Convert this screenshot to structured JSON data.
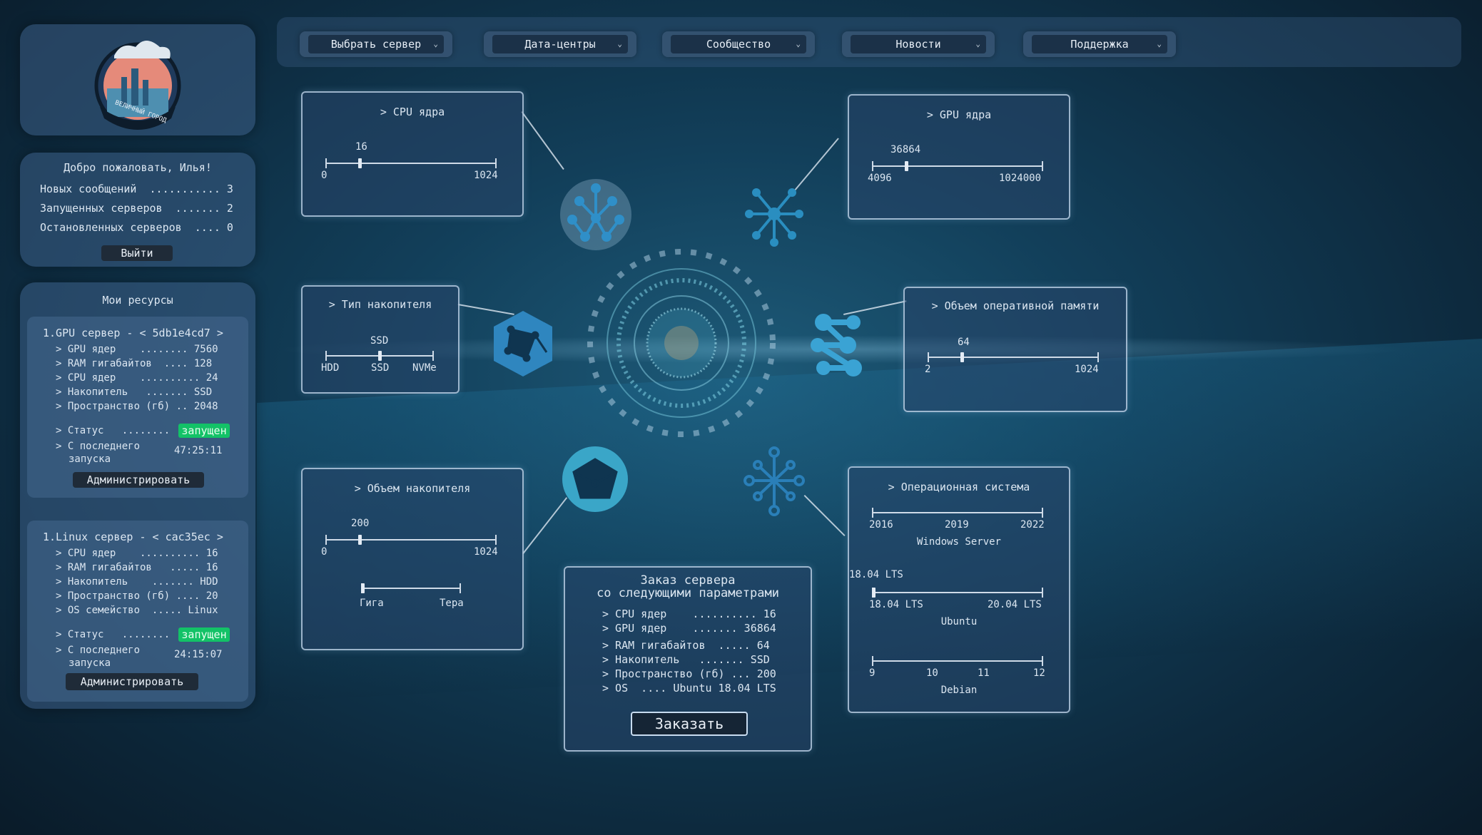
{
  "nav": {
    "items": [
      "Выбрать сервер",
      "Дата-центры",
      "Сообщество",
      "Новости",
      "Поддержка"
    ]
  },
  "logo": {
    "text": "ВЕЛИЧНЫЙ ГОРОД"
  },
  "welcome": {
    "title": "Добро пожаловать, Илья!",
    "rows": [
      "Новых сообщений  ........... 3",
      "Запущенных серверов  ....... 2",
      "Остановленных серверов  .... 0"
    ],
    "logout": "Выйти"
  },
  "resources": {
    "title": "Мои ресурсы",
    "servers": [
      {
        "header": "1.GPU сервер - < 5db1e4cd7 >",
        "rows": [
          "> GPU ядер    ........ 7560",
          "> RAM гигабайтов  .... 128",
          "> CPU ядер    .......... 24",
          "> Накопитель   ....... SSD",
          "> Пространство (гб) .. 2048"
        ],
        "status_label": "> Статус   ........",
        "status": "запущен",
        "since_label_1": "> С последнего",
        "since_label_2": "запуска",
        "since_value": "47:25:11",
        "admin": "Администрировать"
      },
      {
        "header": "1.Linux сервер - < cac35ec >",
        "rows": [
          "> CPU ядер    .......... 16",
          "> RAM гигабайтов   ..... 16",
          "> Накопитель    ....... HDD",
          "> Пространство (гб) .... 20",
          "> OS семейство  ..... Linux"
        ],
        "status_label": "> Статус   ........",
        "status": "запущен",
        "since_label_1": "> С последнего",
        "since_label_2": "запуска",
        "since_value": "24:15:07",
        "admin": "Администрировать"
      }
    ]
  },
  "cpu": {
    "title": "> CPU ядра",
    "value": "16",
    "min": "0",
    "max": "1024",
    "level": 0.2
  },
  "gpu": {
    "title": "> GPU ядра",
    "value": "36864",
    "min": "4096",
    "max": "1024000",
    "level": 0.2
  },
  "storage_type": {
    "title": "> Тип накопителя",
    "selected": "SSD",
    "options": [
      "HDD",
      "SSD",
      "NVMe"
    ]
  },
  "ram": {
    "title": "> Объем оперативной памяти",
    "value": "64",
    "min": "2",
    "max": "1024",
    "level": 0.2
  },
  "storage_size": {
    "title": "> Объем накопителя",
    "value": "200",
    "min": "0",
    "max": "1024",
    "unit_min": "Гига",
    "unit_max": "Тера",
    "level": 0.2
  },
  "os": {
    "title": "> Операционная система",
    "windows": {
      "ticks": [
        "2016",
        "2019",
        "2022"
      ],
      "name": "Windows Server"
    },
    "ubuntu": {
      "selected": "18.04 LTS",
      "ticks": [
        "18.04 LTS",
        "20.04 LTS"
      ],
      "name": "Ubuntu"
    },
    "debian": {
      "ticks": [
        "9",
        "10",
        "11",
        "12"
      ],
      "name": "Debian"
    }
  },
  "order": {
    "title_1": "Заказ сервера",
    "title_2": "со следующими параметрами",
    "rows": [
      "> CPU ядер    .......... 16",
      "> GPU ядер    ....... 36864",
      "> RAM гигабайтов  ..... 64",
      "> Накопитель   ....... SSD",
      "> Пространство (гб) ... 200",
      "> OS  .... Ubuntu 18.04 LTS"
    ],
    "button": "Заказать"
  },
  "colors": {
    "accent_green": "#13c267",
    "panel": "#3c5f87",
    "box_border": "#c8dcf0"
  }
}
